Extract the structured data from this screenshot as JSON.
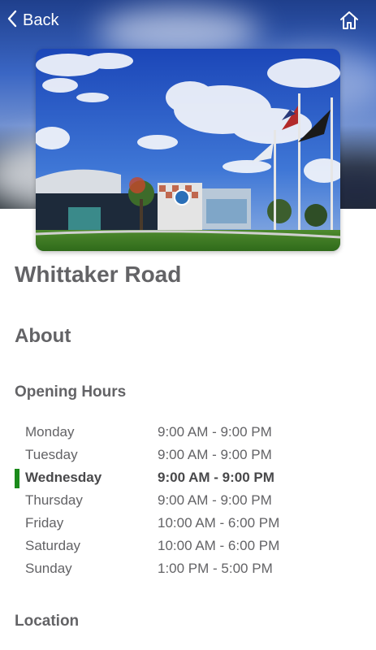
{
  "nav": {
    "back_label": "Back",
    "back_icon": "chevron-left-icon",
    "home_icon": "home-icon"
  },
  "location_name": "Whittaker Road",
  "about_heading": "About",
  "opening_hours": {
    "heading": "Opening Hours",
    "today": "Wednesday",
    "days": [
      {
        "day": "Monday",
        "hours": "9:00 AM - 9:00 PM",
        "is_today": false
      },
      {
        "day": "Tuesday",
        "hours": "9:00 AM - 9:00 PM",
        "is_today": false
      },
      {
        "day": "Wednesday",
        "hours": "9:00 AM - 9:00 PM",
        "is_today": true
      },
      {
        "day": "Thursday",
        "hours": "9:00 AM - 9:00 PM",
        "is_today": false
      },
      {
        "day": "Friday",
        "hours": "10:00 AM - 6:00 PM",
        "is_today": false
      },
      {
        "day": "Saturday",
        "hours": "10:00 AM - 6:00 PM",
        "is_today": false
      },
      {
        "day": "Sunday",
        "hours": "1:00 PM - 5:00 PM",
        "is_today": false
      }
    ]
  },
  "location_heading": "Location",
  "colors": {
    "today_marker": "#1a8a1a",
    "text": "#636366"
  }
}
